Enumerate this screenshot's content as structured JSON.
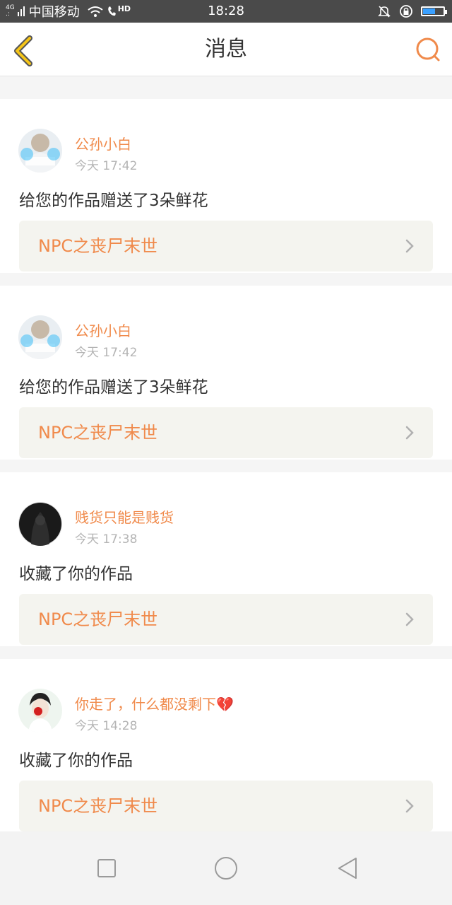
{
  "status_bar": {
    "network": "4G",
    "carrier": "中国移动",
    "hd": "HD",
    "time": "18:28",
    "battery_level": 0.6,
    "icons": [
      "signal-icon",
      "wifi-icon",
      "call-hd-icon",
      "mute-icon",
      "rotation-lock-icon",
      "battery-icon"
    ]
  },
  "nav": {
    "title": "消息",
    "back_icon": "chevron-left-icon",
    "search_icon": "search-icon"
  },
  "colors": {
    "accent": "#f08a4b",
    "back": "#f5c518",
    "text": "#333333",
    "muted": "#b4b4b4",
    "link_bg": "#f4f4ef"
  },
  "messages": [
    {
      "username": "公孙小白",
      "time": "今天 17:42",
      "action": "给您的作品赠送了3朵鲜花",
      "work": "NPC之丧尸末世"
    },
    {
      "username": "公孙小白",
      "time": "今天 17:42",
      "action": "给您的作品赠送了3朵鲜花",
      "work": "NPC之丧尸末世"
    },
    {
      "username": "贱货只能是贱货",
      "time": "今天 17:38",
      "action": "收藏了你的作品",
      "work": "NPC之丧尸末世"
    },
    {
      "username": "你走了，什么都没剩下💔",
      "time": "今天 14:28",
      "action": "收藏了你的作品",
      "work": "NPC之丧尸末世"
    }
  ],
  "system_nav": [
    "recents-square-icon",
    "home-circle-icon",
    "back-triangle-icon"
  ]
}
